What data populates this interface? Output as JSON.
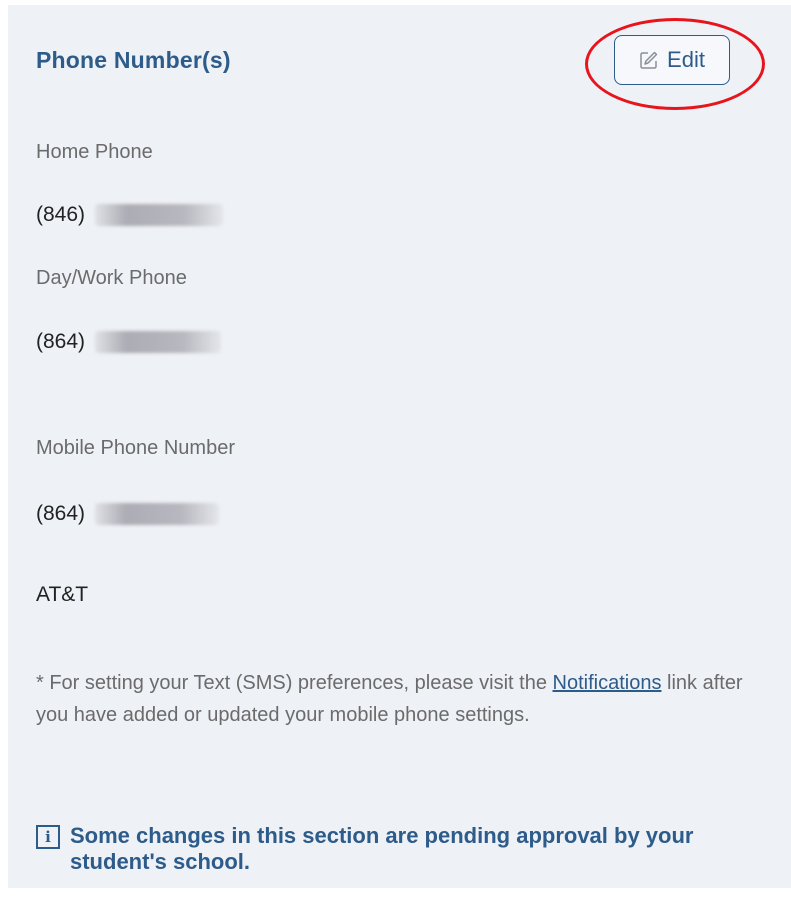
{
  "section": {
    "title": "Phone Number(s)",
    "edit_label": "Edit",
    "edit_icon": "edit-icon"
  },
  "fields": [
    {
      "label": "Home Phone",
      "area_code": "(846)"
    },
    {
      "label": "Day/Work Phone",
      "area_code": "(864)"
    },
    {
      "label": "Mobile Phone Number",
      "area_code": "(864)"
    }
  ],
  "carrier": "AT&T",
  "footnote": {
    "prefix": "* For setting your Text (SMS) preferences, please visit the ",
    "link_text": "Notifications",
    "suffix": " link after you have added or updated your mobile phone settings."
  },
  "pending_notice": {
    "icon": "info-icon",
    "text": "Some changes in this section are pending approval by your student's school."
  },
  "colors": {
    "accent": "#2d5b8a",
    "highlight": "#e8141c",
    "background": "#eef1f6"
  }
}
